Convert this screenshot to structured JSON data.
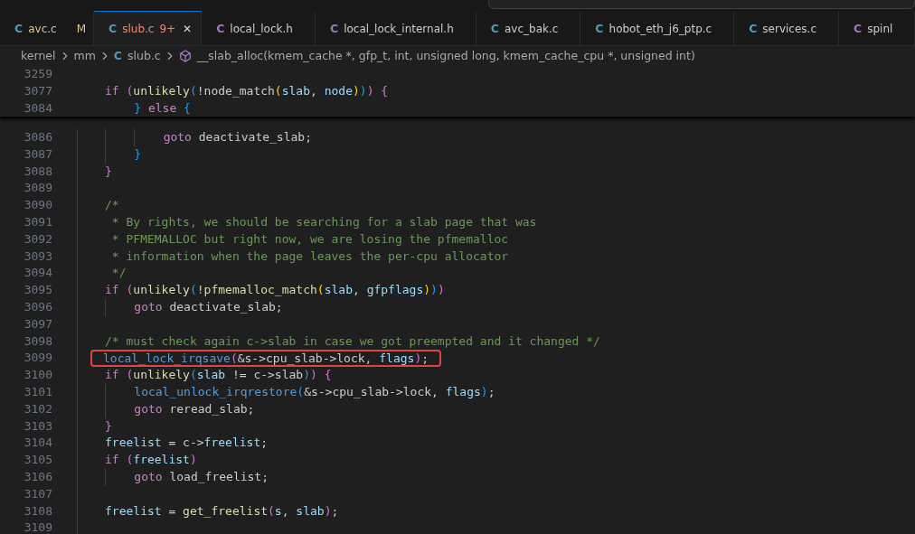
{
  "tabs": [
    {
      "icon": "C",
      "kind": "c",
      "label": "avc.c",
      "color": "#e2c08d",
      "badge": "M",
      "selected": false
    },
    {
      "icon": "C",
      "kind": "c",
      "label": "slub.c",
      "color": "#f48771",
      "badge": "9+",
      "selected": true,
      "close": "✕"
    },
    {
      "icon": "C",
      "kind": "h",
      "label": "local_lock.h",
      "color": "#cccccc",
      "selected": false
    },
    {
      "icon": "C",
      "kind": "h",
      "label": "local_lock_internal.h",
      "color": "#cccccc",
      "selected": false
    },
    {
      "icon": "C",
      "kind": "c",
      "label": "avc_bak.c",
      "color": "#cccccc",
      "selected": false
    },
    {
      "icon": "C",
      "kind": "c",
      "label": "hobot_eth_j6_ptp.c",
      "color": "#cccccc",
      "selected": false
    },
    {
      "icon": "C",
      "kind": "c",
      "label": "services.c",
      "color": "#cccccc",
      "selected": false
    },
    {
      "icon": "C",
      "kind": "h",
      "label": "spinl",
      "color": "#cccccc",
      "selected": false
    }
  ],
  "breadcrumb": [
    {
      "kind": "folder",
      "label": "kernel"
    },
    {
      "kind": "folder",
      "label": "mm"
    },
    {
      "kind": "file",
      "icon": "C",
      "label": "slub.c"
    },
    {
      "kind": "symbol",
      "label": "__slab_alloc(kmem_cache *, gfp_t, int, unsigned long, kmem_cache_cpu *, unsigned int)"
    }
  ],
  "editor": {
    "sticky_lines": [
      {
        "number": "3259"
      },
      {
        "number": "3077",
        "tokens": [
          {
            "text": "if ",
            "kind": "kw"
          },
          {
            "text": "(",
            "kind": "b2"
          },
          {
            "text": "unlikely",
            "kind": "fn"
          },
          {
            "text": "(",
            "kind": "b3"
          },
          {
            "text": "!node_match",
            "kind": "plain"
          },
          {
            "text": "(",
            "kind": "b1"
          },
          {
            "text": "slab",
            "kind": "var"
          },
          {
            "text": ", ",
            "kind": "plain"
          },
          {
            "text": "node",
            "kind": "var"
          },
          {
            "text": ")",
            "kind": "b1"
          },
          {
            "text": ")",
            "kind": "b3"
          },
          {
            "text": ")",
            "kind": "b2"
          },
          {
            "text": " {",
            "kind": "b2"
          }
        ]
      },
      {
        "number": "3084",
        "tokens": [
          {
            "text": "    }",
            "kind": "b3"
          },
          {
            "text": " else",
            "kind": "kw"
          },
          {
            "text": " {",
            "kind": "b3"
          }
        ]
      }
    ],
    "lines": [
      {
        "number": "3086",
        "tokens": [
          {
            "text": "        goto",
            "kind": "kw"
          },
          {
            "text": " deactivate_slab;",
            "kind": "plain"
          }
        ]
      },
      {
        "number": "3087",
        "tokens": [
          {
            "text": "    }",
            "kind": "b3"
          }
        ]
      },
      {
        "number": "3088",
        "tokens": [
          {
            "text": "}",
            "kind": "b2"
          }
        ]
      },
      {
        "number": "3089"
      },
      {
        "number": "3090",
        "tokens": [
          {
            "text": "/*",
            "kind": "comment"
          }
        ]
      },
      {
        "number": "3091",
        "tokens": [
          {
            "text": " * By rights, we should be searching for a slab page that was",
            "kind": "comment"
          }
        ]
      },
      {
        "number": "3092",
        "tokens": [
          {
            "text": " * PFMEMALLOC but right now, we are losing the pfmemalloc",
            "kind": "comment"
          }
        ]
      },
      {
        "number": "3093",
        "tokens": [
          {
            "text": " * information when the page leaves the per-cpu allocator",
            "kind": "comment"
          }
        ]
      },
      {
        "number": "3094",
        "tokens": [
          {
            "text": " */",
            "kind": "comment"
          }
        ]
      },
      {
        "number": "3095",
        "tokens": [
          {
            "text": "if ",
            "kind": "kw"
          },
          {
            "text": "(",
            "kind": "b2"
          },
          {
            "text": "unlikely",
            "kind": "fn"
          },
          {
            "text": "(",
            "kind": "b3"
          },
          {
            "text": "!",
            "kind": "plain"
          },
          {
            "text": "pfmemalloc_match",
            "kind": "fn"
          },
          {
            "text": "(",
            "kind": "b1"
          },
          {
            "text": "slab",
            "kind": "var"
          },
          {
            "text": ", ",
            "kind": "plain"
          },
          {
            "text": "gfpflags",
            "kind": "var"
          },
          {
            "text": ")",
            "kind": "b1"
          },
          {
            "text": ")",
            "kind": "b3"
          },
          {
            "text": ")",
            "kind": "b2"
          }
        ]
      },
      {
        "number": "3096",
        "tokens": [
          {
            "text": "    goto",
            "kind": "kw"
          },
          {
            "text": " deactivate_slab;",
            "kind": "plain"
          }
        ]
      },
      {
        "number": "3097"
      },
      {
        "number": "3098",
        "tokens": [
          {
            "text": "/* must check again c->slab in case we got preempted and it changed */",
            "kind": "comment"
          }
        ]
      },
      {
        "number": "3099",
        "highlighted": true,
        "tokens": [
          {
            "text": "local_lock_irqsave",
            "kind": "macrofn"
          },
          {
            "text": "(",
            "kind": "b2"
          },
          {
            "text": "&s->cpu_slab->lock, ",
            "kind": "plain"
          },
          {
            "text": "flags",
            "kind": "var"
          },
          {
            "text": ")",
            "kind": "b2"
          },
          {
            "text": ";",
            "kind": "plain"
          }
        ]
      },
      {
        "number": "3100",
        "tokens": [
          {
            "text": "if ",
            "kind": "kw"
          },
          {
            "text": "(",
            "kind": "b2"
          },
          {
            "text": "unlikely",
            "kind": "fn"
          },
          {
            "text": "(",
            "kind": "b3"
          },
          {
            "text": "slab",
            "kind": "var"
          },
          {
            "text": " != c->slab",
            "kind": "plain"
          },
          {
            "text": ")",
            "kind": "b3"
          },
          {
            "text": ")",
            "kind": "b2"
          },
          {
            "text": " {",
            "kind": "b2"
          }
        ]
      },
      {
        "number": "3101",
        "tokens": [
          {
            "text": "    local_unlock_irqrestore",
            "kind": "macrofn"
          },
          {
            "text": "(",
            "kind": "b3"
          },
          {
            "text": "&s->cpu_slab->lock, ",
            "kind": "plain"
          },
          {
            "text": "flags",
            "kind": "var"
          },
          {
            "text": ")",
            "kind": "b3"
          },
          {
            "text": ";",
            "kind": "plain"
          }
        ]
      },
      {
        "number": "3102",
        "tokens": [
          {
            "text": "    goto",
            "kind": "kw"
          },
          {
            "text": " reread_slab;",
            "kind": "plain"
          }
        ]
      },
      {
        "number": "3103",
        "tokens": [
          {
            "text": "}",
            "kind": "b2"
          }
        ]
      },
      {
        "number": "3104",
        "tokens": [
          {
            "text": "freelist",
            "kind": "var"
          },
          {
            "text": " = c->",
            "kind": "plain"
          },
          {
            "text": "freelist",
            "kind": "var"
          },
          {
            "text": ";",
            "kind": "plain"
          }
        ]
      },
      {
        "number": "3105",
        "tokens": [
          {
            "text": "if ",
            "kind": "kw"
          },
          {
            "text": "(",
            "kind": "b2"
          },
          {
            "text": "freelist",
            "kind": "var"
          },
          {
            "text": ")",
            "kind": "b2"
          }
        ]
      },
      {
        "number": "3106",
        "tokens": [
          {
            "text": "    goto",
            "kind": "kw"
          },
          {
            "text": " load_freelist;",
            "kind": "plain"
          }
        ]
      },
      {
        "number": "3107"
      },
      {
        "number": "3108",
        "tokens": [
          {
            "text": "freelist",
            "kind": "var"
          },
          {
            "text": " = ",
            "kind": "plain"
          },
          {
            "text": "get_freelist",
            "kind": "fn"
          },
          {
            "text": "(",
            "kind": "b2"
          },
          {
            "text": "s",
            "kind": "var"
          },
          {
            "text": ", ",
            "kind": "plain"
          },
          {
            "text": "slab",
            "kind": "var"
          },
          {
            "text": ")",
            "kind": "b2"
          },
          {
            "text": ";",
            "kind": "plain"
          }
        ]
      },
      {
        "number": "3109"
      }
    ]
  }
}
